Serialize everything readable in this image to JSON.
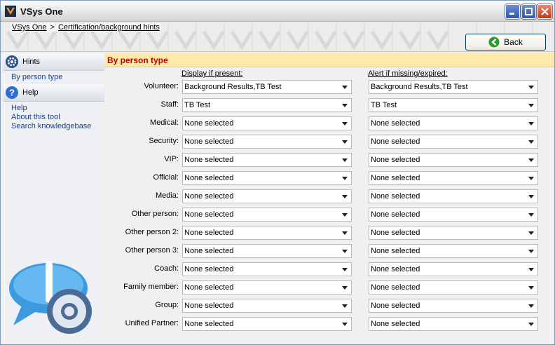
{
  "window": {
    "title": "VSys One"
  },
  "breadcrumb": [
    "VSys One",
    "Certification/background hints"
  ],
  "back_button": {
    "label": "Back"
  },
  "sidebar": {
    "hints_header": "Hints",
    "hints_items": [
      {
        "label": "By person type"
      }
    ],
    "help_header": "Help",
    "help_items": [
      {
        "label": "Help"
      },
      {
        "label": "About this tool"
      },
      {
        "label": "Search knowledgebase"
      }
    ]
  },
  "main": {
    "section_title": "By person type",
    "col_display": "Display if present:",
    "col_alert": "Alert if missing/expired:",
    "rows": [
      {
        "label": "Volunteer:",
        "display": "Background Results,TB Test",
        "alert": "Background Results,TB Test"
      },
      {
        "label": "Staff:",
        "display": "TB Test",
        "alert": "TB Test"
      },
      {
        "label": "Medical:",
        "display": "None selected",
        "alert": "None selected"
      },
      {
        "label": "Security:",
        "display": "None selected",
        "alert": "None selected"
      },
      {
        "label": "VIP:",
        "display": "None selected",
        "alert": "None selected"
      },
      {
        "label": "Official:",
        "display": "None selected",
        "alert": "None selected"
      },
      {
        "label": "Media:",
        "display": "None selected",
        "alert": "None selected"
      },
      {
        "label": "Other person:",
        "display": "None selected",
        "alert": "None selected"
      },
      {
        "label": "Other person 2:",
        "display": "None selected",
        "alert": "None selected"
      },
      {
        "label": "Other person 3:",
        "display": "None selected",
        "alert": "None selected"
      },
      {
        "label": "Coach:",
        "display": "None selected",
        "alert": "None selected"
      },
      {
        "label": "Family member:",
        "display": "None selected",
        "alert": "None selected"
      },
      {
        "label": "Group:",
        "display": "None selected",
        "alert": "None selected"
      },
      {
        "label": "Unified Partner:",
        "display": "None selected",
        "alert": "None selected"
      }
    ]
  },
  "colors": {
    "section_header_bg": "#fde9a8",
    "section_title": "#c00000",
    "link": "#1a3f8a",
    "accent_orange": "#f0a020"
  }
}
